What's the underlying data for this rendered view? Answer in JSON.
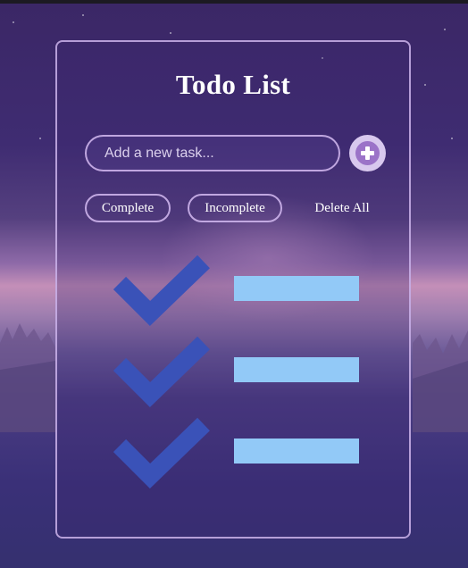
{
  "app": {
    "title": "Todo List"
  },
  "input": {
    "placeholder": "Add a new task...",
    "value": ""
  },
  "add_button": {
    "icon": "plus-icon"
  },
  "filters": {
    "complete": "Complete",
    "incomplete": "Incomplete",
    "delete_all": "Delete All"
  },
  "placeholder_items": [
    {
      "icon": "checkmark-icon"
    },
    {
      "icon": "checkmark-icon"
    },
    {
      "icon": "checkmark-icon"
    }
  ],
  "colors": {
    "checkmark": "#3a52b8",
    "bar": "#92c9f7",
    "add_button_outer": "#d8c8ee",
    "add_button_inner": "#9b73c8",
    "border": "#cdb4eb"
  }
}
